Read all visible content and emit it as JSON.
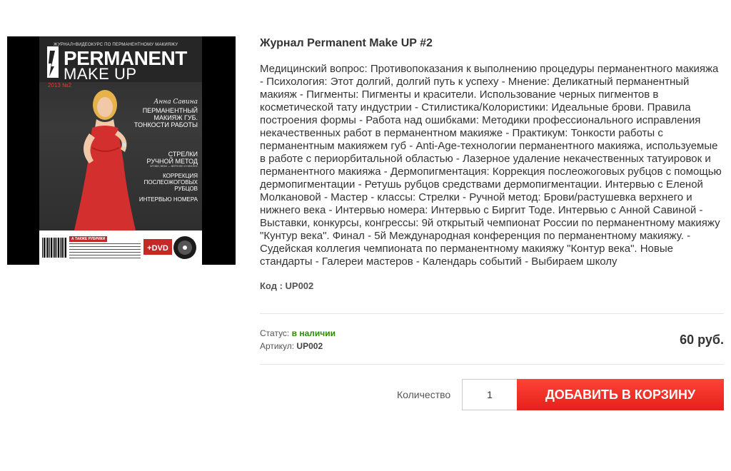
{
  "product": {
    "title": "Журнал Permanent Make UP #2",
    "description": "Медицинский вопрос: Противопоказания к выполнению процедуры перманентного макияжа - Психология: Этот долгий, долгий путь к успеху - Мнение: Деликатный перманентный макияж - Пигменты: Пигменты и красители. Использование черных пигментов в косметической тату индустрии - Стилистика/Колористики: Идеальные брови. Правила построения формы - Работа над ошибками: Методики профессионального исправления некачественных работ в перманентном макияже - Практикум: Тонкости работы с перманентным макияжем губ - Anti-Age-технологии перманентного макияжа, используемые в работе с периорбитальной областью - Лазерное удаление некачественных татуировок и перманентного макияжа - Дермопигментация: Коррекция послеожоговых рубцов с помощью дермопигментации - Ретушь рубцов средствами дермопигментации. Интервью с Еленой Молкановой - Мастер - классы: Стрелки - Ручной метод: Брови/растушевка верхнего и нижнего века - Интервью номера: Интервью с Биргит Тоде. Интервью с Анной Савиной - Выставки, конкурсы, конгрессы: 9й открытый чемпионат России по перманентному макияжу \"Кунтур века\". Финал - 5й Международная конференция по перманентному макияжу. - Судейская коллегия чемпионата по перманентному макияжу \"Контур века\". Новые стандарты - Галереи мастеров - Календарь событий - Выбираем школу",
    "code_line": "Код : UP002",
    "status_label": "Статус:",
    "status_value": "в наличии",
    "sku_label": "Артикул:",
    "sku_value": "UP002",
    "price": "60 руб.",
    "quantity_label": "Количество",
    "quantity_value": "1",
    "add_to_cart_label": "Добавить в корзину"
  },
  "cover": {
    "tagline": "ЖУРНАЛ+ВИДЕОКУРС ПО ПЕРМАНЕНТНОМУ МАКИЯЖУ",
    "brand_line1": "PERMANENT",
    "brand_line2": "MAKE UP",
    "year": "2013 №2",
    "signature": "Анна Савина",
    "headline1": "ПЕРМАНЕНТНЫЙ МАКИЯЖ ГУБ. ТОНКОСТИ РАБОТЫ",
    "headline2": "СТРЕЛКИ",
    "headline3": "РУЧНОЙ МЕТОД",
    "headline3_sub": "БРОВИ, ВЕКИ — ВЕРХНЕЕ И НИЖНЕЕ",
    "headline4": "КОРРЕКЦИЯ ПОСЛЕОЖОГОВЫХ РУБЦОВ",
    "headline5": "ИНТЕРВЬЮ НОМЕРА",
    "also_label": "А ТАКЖЕ РУБРИКИ",
    "dvd_label": "+DVD",
    "colors": {
      "accent_red": "#e4201a",
      "dress_red": "#d32f2f",
      "status_green": "#2e8b00"
    }
  }
}
